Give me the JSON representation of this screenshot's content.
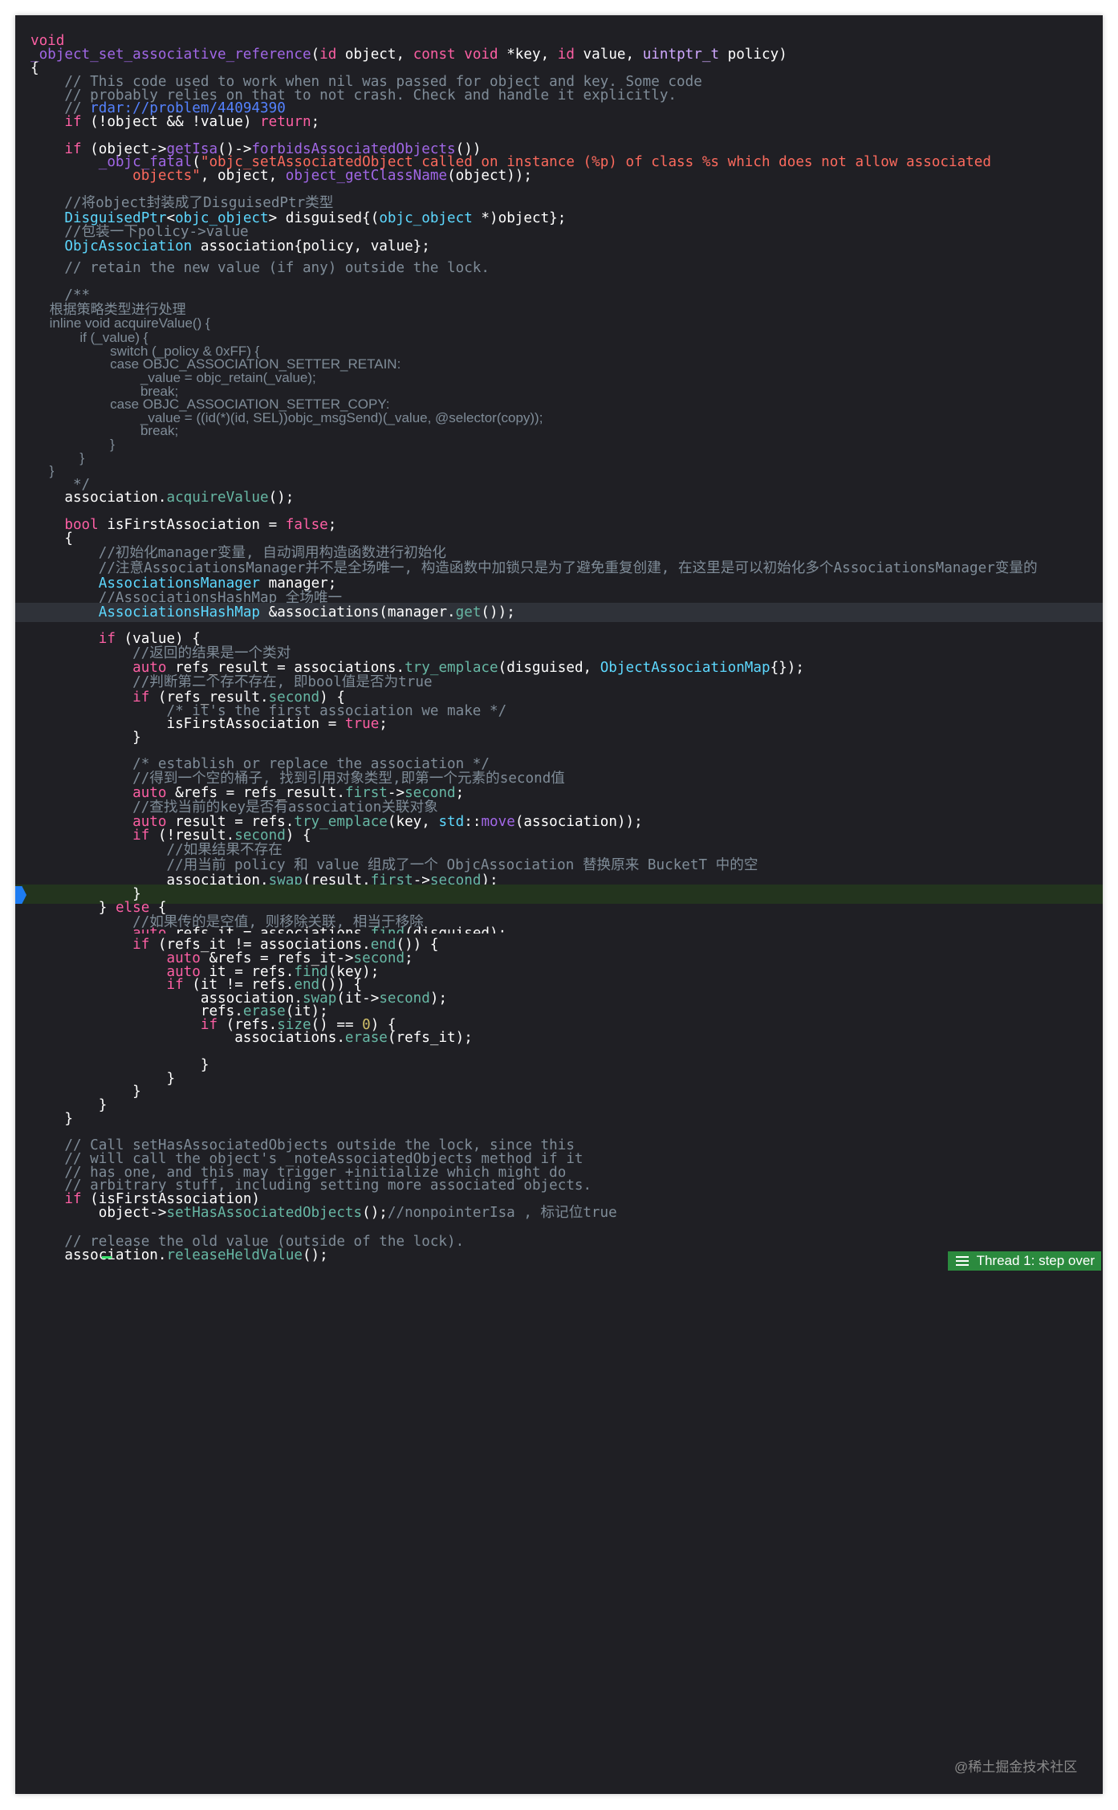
{
  "editor": {
    "lines": [
      {
        "t": "void",
        "c": "kw"
      },
      {
        "segs": [
          [
            "_object_set_associative_reference",
            "fn"
          ],
          [
            "(",
            ""
          ],
          [
            "id",
            "kw"
          ],
          [
            " object, ",
            ""
          ],
          [
            "const",
            "kw"
          ],
          [
            " ",
            ""
          ],
          [
            "void",
            "kw"
          ],
          [
            " *key, ",
            ""
          ],
          [
            "id",
            "kw"
          ],
          [
            " value, ",
            ""
          ],
          [
            "uintptr_t",
            "ty"
          ],
          [
            " policy)",
            ""
          ]
        ]
      },
      {
        "t": "{"
      },
      {
        "t": ""
      },
      {
        "t": "    // This code used to work when nil was passed for object and key. Some code",
        "c": "cm"
      },
      {
        "t": "    // probably relies on that to not crash. Check and handle it explicitly.",
        "c": "cm"
      },
      {
        "segs": [
          [
            "    // ",
            "cm"
          ],
          [
            "rdar://problem/44094390",
            "url"
          ]
        ]
      },
      {
        "segs": [
          [
            "    ",
            ""
          ],
          [
            "if",
            "kw"
          ],
          [
            " (!object && !value) ",
            ""
          ],
          [
            "return",
            "kw"
          ],
          [
            ";",
            ""
          ]
        ]
      },
      {
        "t": ""
      },
      {
        "segs": [
          [
            "    ",
            ""
          ],
          [
            "if",
            "kw"
          ],
          [
            " (object->",
            ""
          ],
          [
            "getIsa",
            "fn"
          ],
          [
            "()->",
            ""
          ],
          [
            "forbidsAssociatedObjects",
            "fn"
          ],
          [
            "())",
            ""
          ]
        ]
      },
      {
        "segs": [
          [
            "        ",
            ""
          ],
          [
            "_objc_fatal",
            "fn"
          ],
          [
            "(",
            ""
          ],
          [
            "\"objc_setAssociatedObject called on instance (%p) of class %s which does not allow associated",
            "str"
          ]
        ]
      },
      {
        "segs": [
          [
            "            ",
            ""
          ],
          [
            "objects\"",
            "str"
          ],
          [
            ", object, ",
            ""
          ],
          [
            "object_getClassName",
            "fn"
          ],
          [
            "(object));",
            ""
          ]
        ]
      },
      {
        "t": ""
      },
      {
        "t": "    //将object封装成了DisguisedPtr类型",
        "c": "cm"
      },
      {
        "segs": [
          [
            "    ",
            ""
          ],
          [
            "DisguisedPtr",
            "tyP"
          ],
          [
            "<",
            ""
          ],
          [
            "objc_object",
            "tyP"
          ],
          [
            "> disguised{(",
            ""
          ],
          [
            "objc_object",
            "tyP"
          ],
          [
            " *)object};",
            ""
          ]
        ]
      },
      {
        "t": "    //包装一下policy->value",
        "c": "cm"
      },
      {
        "segs": [
          [
            "    ",
            ""
          ],
          [
            "ObjcAssociation",
            "tyP"
          ],
          [
            " association{policy, value};",
            ""
          ]
        ]
      },
      {
        "t": ""
      },
      {
        "t": "    // retain the new value (if any) outside the lock.",
        "c": "cm"
      },
      {
        "t": ""
      },
      {
        "t": "    /**",
        "c": "cm"
      },
      {
        "t": "     根据策略类型进行处理",
        "c": "cm",
        "prose": true
      },
      {
        "t": "     inline void acquireValue() {",
        "c": "cm",
        "prose": true
      },
      {
        "t": "             if (_value) {",
        "c": "cm",
        "prose": true
      },
      {
        "t": "                     switch (_policy & 0xFF) {",
        "c": "cm",
        "prose": true
      },
      {
        "t": "                     case OBJC_ASSOCIATION_SETTER_RETAIN:",
        "c": "cm",
        "prose": true
      },
      {
        "t": "                             _value = objc_retain(_value);",
        "c": "cm",
        "prose": true
      },
      {
        "t": "                             break;",
        "c": "cm",
        "prose": true
      },
      {
        "t": "                     case OBJC_ASSOCIATION_SETTER_COPY:",
        "c": "cm",
        "prose": true
      },
      {
        "t": "                             _value = ((id(*)(id, SEL))objc_msgSend)(_value, @selector(copy));",
        "c": "cm",
        "prose": true
      },
      {
        "t": "                             break;",
        "c": "cm",
        "prose": true
      },
      {
        "t": "                     }",
        "c": "cm",
        "prose": true
      },
      {
        "t": "             }",
        "c": "cm",
        "prose": true
      },
      {
        "t": "     }",
        "c": "cm",
        "prose": true
      },
      {
        "t": "     */",
        "c": "cm"
      },
      {
        "segs": [
          [
            "    association.",
            ""
          ],
          [
            "acquireValue",
            "fnP"
          ],
          [
            "();",
            ""
          ]
        ]
      },
      {
        "t": ""
      },
      {
        "segs": [
          [
            "    ",
            ""
          ],
          [
            "bool",
            "kw"
          ],
          [
            " isFirstAssociation = ",
            ""
          ],
          [
            "false",
            "kw"
          ],
          [
            ";",
            ""
          ]
        ]
      },
      {
        "t": "    {"
      },
      {
        "t": "        //初始化manager变量, 自动调用构造函数进行初始化",
        "c": "cm"
      },
      {
        "t": "        //注意AssociationsManager并不是全场唯一, 构造函数中加锁只是为了避免重复创建, 在这里是可以初始化多个AssociationsManager变量的",
        "c": "cm"
      },
      {
        "segs": [
          [
            "        ",
            ""
          ],
          [
            "AssociationsManager",
            "tyP"
          ],
          [
            " manager;",
            ""
          ]
        ]
      },
      {
        "t": "        //AssociationsHashMap 全场唯一",
        "c": "cm"
      },
      {
        "segs": [
          [
            "        ",
            ""
          ],
          [
            "AssociationsHashMap",
            "tyP"
          ],
          [
            " &associations(manager.",
            ""
          ],
          [
            "get",
            "fnP"
          ],
          [
            "());",
            ""
          ]
        ],
        "hl": "hl"
      },
      {
        "t": ""
      },
      {
        "segs": [
          [
            "        ",
            ""
          ],
          [
            "if",
            "kw"
          ],
          [
            " (value) {",
            ""
          ]
        ]
      },
      {
        "t": "            //返回的结果是一个类对",
        "c": "cm"
      },
      {
        "segs": [
          [
            "            ",
            ""
          ],
          [
            "auto",
            "kw"
          ],
          [
            " refs_result = associations.",
            ""
          ],
          [
            "try_emplace",
            "fnP"
          ],
          [
            "(disguised, ",
            ""
          ],
          [
            "ObjectAssociationMap",
            "tyP"
          ],
          [
            "{});",
            ""
          ]
        ]
      },
      {
        "t": "            //判断第二个存不存在, 即bool值是否为true",
        "c": "cm"
      },
      {
        "segs": [
          [
            "            ",
            ""
          ],
          [
            "if",
            "kw"
          ],
          [
            " (refs_result.",
            ""
          ],
          [
            "second",
            "fnP"
          ],
          [
            ") {",
            ""
          ]
        ]
      },
      {
        "t": "                /* it's the first association we make */",
        "c": "cm"
      },
      {
        "segs": [
          [
            "                isFirstAssociation = ",
            ""
          ],
          [
            "true",
            "kw"
          ],
          [
            ";",
            ""
          ]
        ]
      },
      {
        "t": "            }"
      },
      {
        "t": ""
      },
      {
        "t": "            /* establish or replace the association */",
        "c": "cm"
      },
      {
        "t": "            //得到一个空的桶子, 找到引用对象类型,即第一个元素的second值",
        "c": "cm"
      },
      {
        "segs": [
          [
            "            ",
            ""
          ],
          [
            "auto",
            "kw"
          ],
          [
            " &refs = refs_result.",
            ""
          ],
          [
            "first",
            "fnP"
          ],
          [
            "->",
            ""
          ],
          [
            "second",
            "fnP"
          ],
          [
            ";",
            ""
          ]
        ]
      },
      {
        "t": "            //查找当前的key是否有association关联对象",
        "c": "cm"
      },
      {
        "segs": [
          [
            "            ",
            ""
          ],
          [
            "auto",
            "kw"
          ],
          [
            " result = refs.",
            ""
          ],
          [
            "try_emplace",
            "fnP"
          ],
          [
            "(key, ",
            ""
          ],
          [
            "std",
            "tyP"
          ],
          [
            "::",
            ""
          ],
          [
            "move",
            "fn"
          ],
          [
            "(association));",
            ""
          ]
        ]
      },
      {
        "segs": [
          [
            "            ",
            ""
          ],
          [
            "if",
            "kw"
          ],
          [
            " (!result.",
            ""
          ],
          [
            "second",
            "fnP"
          ],
          [
            ") {",
            ""
          ]
        ]
      },
      {
        "t": "                //如果结果不存在",
        "c": "cm"
      },
      {
        "t": "                //用当前 policy 和 value 组成了一个 ObjcAssociation 替换原来 BucketT 中的空",
        "c": "cm"
      },
      {
        "segs": [
          [
            "                association.",
            ""
          ],
          [
            "swap",
            "fnP"
          ],
          [
            "(result.",
            ""
          ],
          [
            "first",
            "fnP"
          ],
          [
            "->",
            ""
          ],
          [
            "second",
            "fnP"
          ],
          [
            ");",
            ""
          ]
        ]
      },
      {
        "t": "            }",
        "hl": "hl-green"
      },
      {
        "segs": [
          [
            "        } ",
            ""
          ],
          [
            "else",
            "kw"
          ],
          [
            " {",
            ""
          ]
        ]
      },
      {
        "t": "            //如果传的是空值, 则移除关联, 相当于移除",
        "c": "cm"
      },
      {
        "segs": [
          [
            "            ",
            ""
          ],
          [
            "auto",
            "kw"
          ],
          [
            " refs_it = associations.",
            ""
          ],
          [
            "find",
            "fnP"
          ],
          [
            "(disguised);",
            ""
          ]
        ],
        "clip": true
      },
      {
        "segs": [
          [
            "            ",
            ""
          ],
          [
            "if",
            "kw"
          ],
          [
            " (refs_it != associations.",
            ""
          ],
          [
            "end",
            "fnP"
          ],
          [
            "()) {",
            ""
          ]
        ]
      },
      {
        "segs": [
          [
            "                ",
            ""
          ],
          [
            "auto",
            "kw"
          ],
          [
            " &refs = refs_it->",
            ""
          ],
          [
            "second",
            "fnP"
          ],
          [
            ";",
            ""
          ]
        ]
      },
      {
        "segs": [
          [
            "                ",
            ""
          ],
          [
            "auto",
            "kw"
          ],
          [
            " it = refs.",
            ""
          ],
          [
            "find",
            "fnP"
          ],
          [
            "(key);",
            ""
          ]
        ]
      },
      {
        "segs": [
          [
            "                ",
            ""
          ],
          [
            "if",
            "kw"
          ],
          [
            " (it != refs.",
            ""
          ],
          [
            "end",
            "fnP"
          ],
          [
            "()) {",
            ""
          ]
        ]
      },
      {
        "segs": [
          [
            "                    association.",
            ""
          ],
          [
            "swap",
            "fnP"
          ],
          [
            "(it->",
            ""
          ],
          [
            "second",
            "fnP"
          ],
          [
            ");",
            ""
          ]
        ]
      },
      {
        "segs": [
          [
            "                    refs.",
            ""
          ],
          [
            "erase",
            "fnP"
          ],
          [
            "(it);",
            ""
          ]
        ]
      },
      {
        "segs": [
          [
            "                    ",
            ""
          ],
          [
            "if",
            "kw"
          ],
          [
            " (refs.",
            ""
          ],
          [
            "size",
            "fnP"
          ],
          [
            "() == ",
            ""
          ],
          [
            "0",
            "num"
          ],
          [
            ") {",
            ""
          ]
        ]
      },
      {
        "segs": [
          [
            "                        associations.",
            ""
          ],
          [
            "erase",
            "fnP"
          ],
          [
            "(refs_it);",
            ""
          ]
        ]
      },
      {
        "t": ""
      },
      {
        "t": "                    }"
      },
      {
        "t": "                }"
      },
      {
        "t": "            }"
      },
      {
        "t": "        }"
      },
      {
        "t": "    }"
      },
      {
        "t": ""
      },
      {
        "t": "    // Call setHasAssociatedObjects outside the lock, since this",
        "c": "cm"
      },
      {
        "t": "    // will call the object's _noteAssociatedObjects method if it",
        "c": "cm"
      },
      {
        "t": "    // has one, and this may trigger +initialize which might do",
        "c": "cm"
      },
      {
        "t": "    // arbitrary stuff, including setting more associated objects.",
        "c": "cm"
      },
      {
        "segs": [
          [
            "    ",
            ""
          ],
          [
            "if",
            "kw"
          ],
          [
            " (isFirstAssociation)",
            ""
          ]
        ]
      },
      {
        "segs": [
          [
            "        object->",
            ""
          ],
          [
            "setHasAssociatedObjects",
            "fnP"
          ],
          [
            "();",
            ""
          ],
          [
            "//nonpointerIsa , 标记位true",
            "cm"
          ]
        ]
      },
      {
        "t": ""
      },
      {
        "t": "    // release the old value (outside of the lock).",
        "c": "cm"
      },
      {
        "segs": [
          [
            "    association.",
            ""
          ],
          [
            "releaseHeldValue",
            "fnP"
          ],
          [
            "();",
            ""
          ]
        ]
      }
    ]
  },
  "debugger": {
    "thread_label": "Thread 1: step over",
    "icon": "lines-icon"
  },
  "watermark": "@稀土掘金技术社区",
  "colors": {
    "background": "#1f1f24",
    "keyword": "#fc5fa3",
    "type": "#5dd8ff",
    "function": "#67b7a4",
    "string": "#fc6a5d",
    "comment": "#7f8c98",
    "number": "#d0bf69",
    "link": "#5482ff",
    "thread_badge": "#2b8a3e"
  }
}
